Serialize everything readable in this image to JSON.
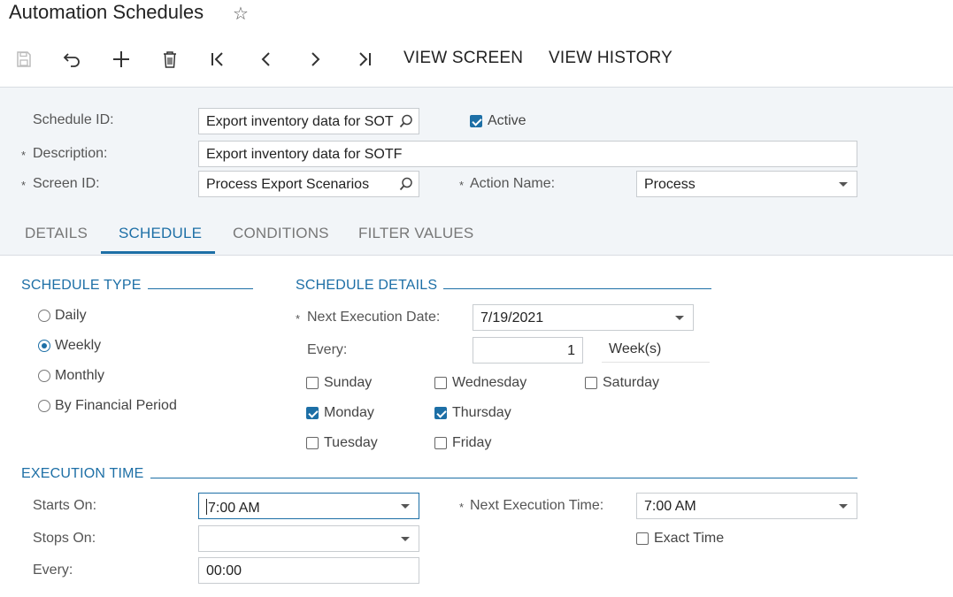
{
  "header": {
    "title": "Automation Schedules"
  },
  "toolbar": {
    "view_screen": "VIEW SCREEN",
    "view_history": "VIEW HISTORY"
  },
  "form": {
    "schedule_id_label": "Schedule ID:",
    "schedule_id_value": "Export inventory data for SOT",
    "active_label": "Active",
    "description_label": "Description:",
    "description_value": "Export inventory data for SOTF",
    "screen_id_label": "Screen ID:",
    "screen_id_value": "Process Export Scenarios",
    "action_name_label": "Action Name:",
    "action_name_value": "Process",
    "required_marker": "*"
  },
  "tabs": [
    "DETAILS",
    "SCHEDULE",
    "CONDITIONS",
    "FILTER VALUES"
  ],
  "schedule_type": {
    "header": "SCHEDULE TYPE",
    "options": [
      "Daily",
      "Weekly",
      "Monthly",
      "By Financial Period"
    ],
    "selected": "Weekly"
  },
  "schedule_details": {
    "header": "SCHEDULE DETAILS",
    "next_exec_date_label": "Next Execution Date:",
    "next_exec_date_value": "7/19/2021",
    "every_label": "Every:",
    "every_value": "1",
    "every_unit": "Week(s)",
    "days": {
      "sunday": "Sunday",
      "monday": "Monday",
      "tuesday": "Tuesday",
      "wednesday": "Wednesday",
      "thursday": "Thursday",
      "friday": "Friday",
      "saturday": "Saturday"
    }
  },
  "execution_time": {
    "header": "EXECUTION TIME",
    "starts_on_label": "Starts On:",
    "starts_on_value": "7:00 AM",
    "stops_on_label": "Stops On:",
    "stops_on_value": "",
    "every_label": "Every:",
    "every_value": "00:00",
    "next_exec_time_label": "Next Execution Time:",
    "next_exec_time_value": "7:00 AM",
    "exact_time_label": "Exact Time"
  },
  "colors": {
    "accent": "#1d6fa6",
    "panel_bg": "#f2f5f8"
  }
}
